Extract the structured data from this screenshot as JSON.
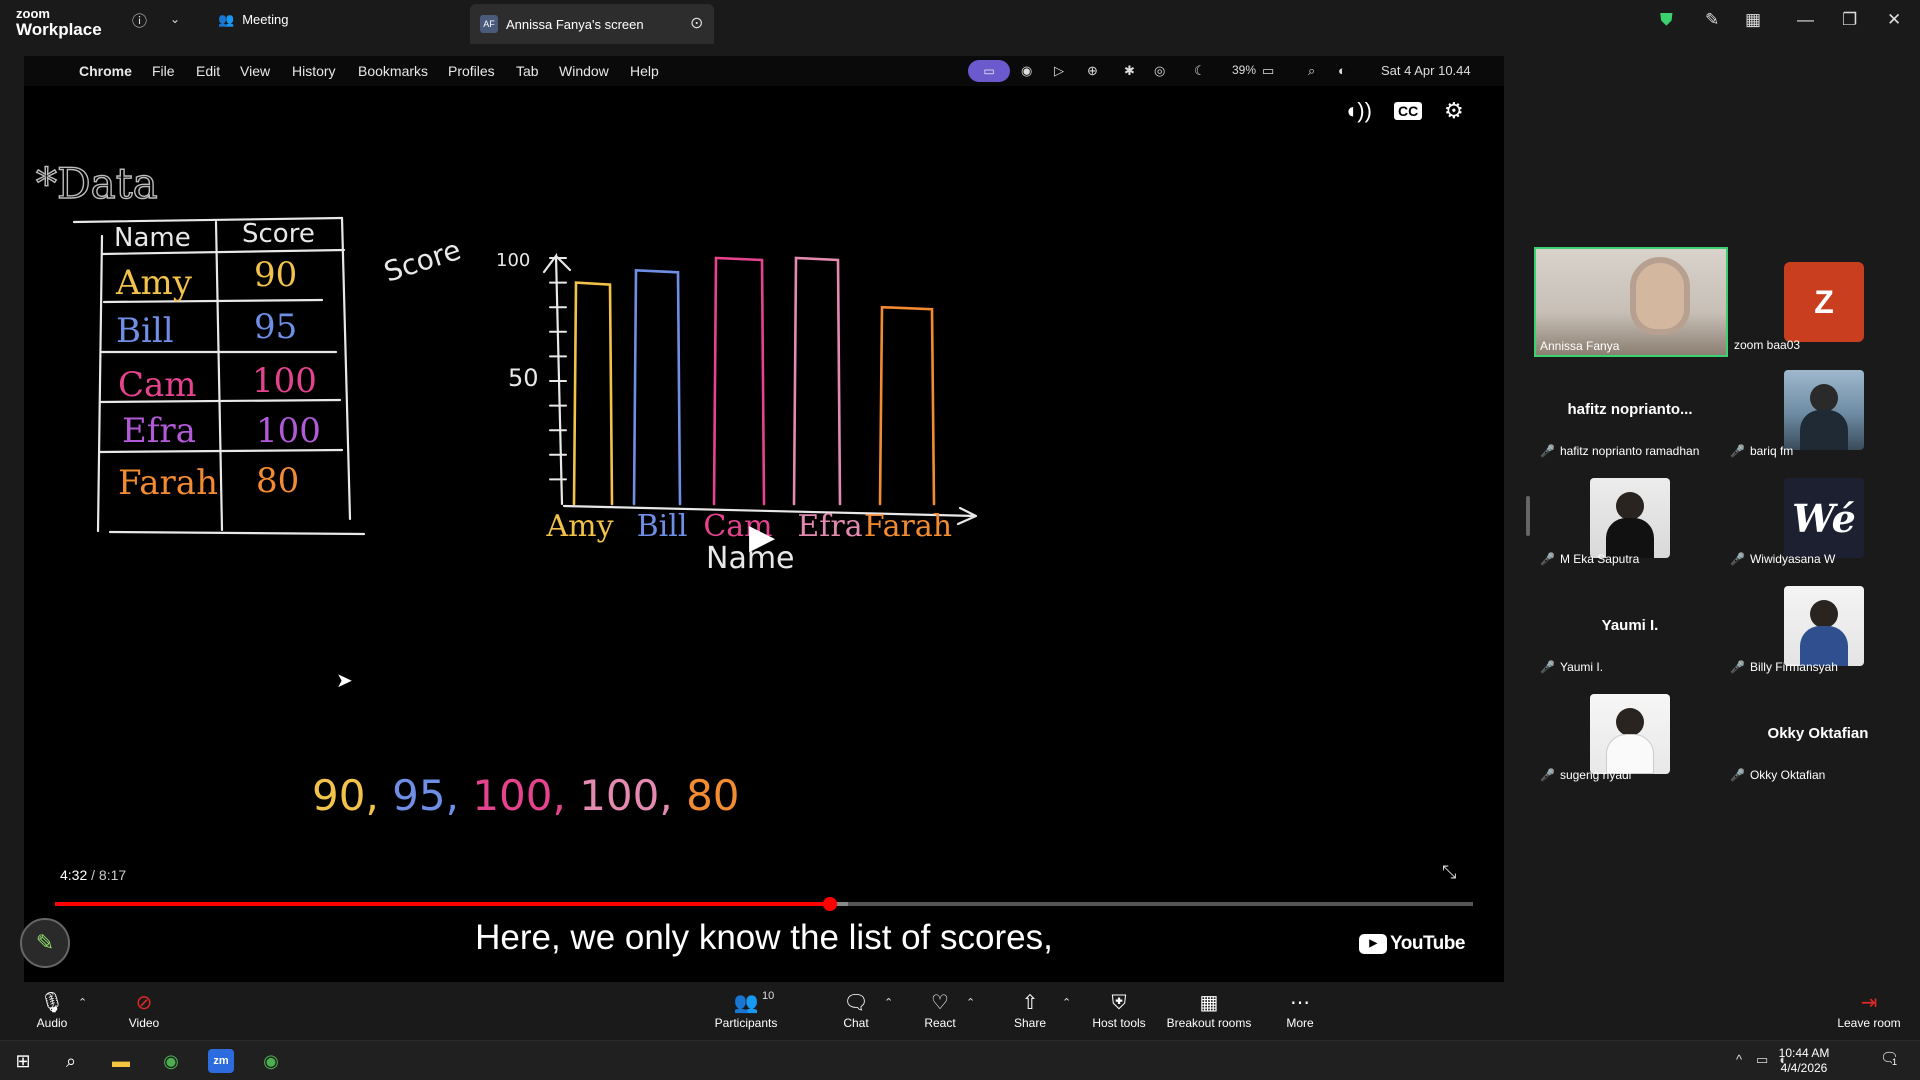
{
  "zoom": {
    "logo_top": "zoom",
    "logo_bottom": "Workplace",
    "meeting_label": "Meeting",
    "shared_tab_avatar": "AF",
    "shared_tab_title": "Annissa Fanya's screen"
  },
  "mac_menubar": {
    "app": "Chrome",
    "menus": [
      "File",
      "Edit",
      "View",
      "History",
      "Bookmarks",
      "Profiles",
      "Tab",
      "Window",
      "Help"
    ],
    "battery": "39%",
    "datetime": "Sat 4 Apr 10.44"
  },
  "video": {
    "current_time": "4:32",
    "separator": " / ",
    "duration": "8:17",
    "progress_fraction": 0.5466,
    "buffered_fraction": 0.559,
    "caption": "Here, we only know the list of scores,",
    "youtube_label": "YouTube",
    "cc_label": "CC"
  },
  "whiteboard": {
    "heading": "*Data",
    "table_headers": [
      "Name",
      "Score"
    ],
    "table_rows": [
      [
        "Amy",
        "90"
      ],
      [
        "Bill",
        "95"
      ],
      [
        "Cam",
        "100"
      ],
      [
        "Efra",
        "100"
      ],
      [
        "Farah",
        "80"
      ]
    ],
    "ylabel": "Score",
    "xlabel": "Name",
    "ytick_labels": [
      "100",
      "50"
    ],
    "bar_names": [
      "Amy",
      "Bill",
      "Cam",
      "Efra",
      "Farah"
    ],
    "score_list": "90, 95, 100, 100, 80"
  },
  "chart_data": {
    "type": "bar",
    "categories": [
      "Amy",
      "Bill",
      "Cam",
      "Efra",
      "Farah"
    ],
    "values": [
      90,
      95,
      100,
      100,
      80
    ],
    "xlabel": "Name",
    "ylabel": "Score",
    "ylim": [
      0,
      100
    ],
    "colors": [
      "#f2c24a",
      "#6f8fe6",
      "#e6438f",
      "#e48ab0",
      "#f28b32"
    ]
  },
  "participants": [
    {
      "name": "Annissa Fanya",
      "type": "video",
      "muted": false
    },
    {
      "name": "zoom baa03",
      "type": "letter",
      "letter": "Z"
    },
    {
      "name": "hafitz noprianto ramadhan",
      "display": "hafitz  noprianto...",
      "type": "name",
      "muted": true
    },
    {
      "name": "bariq fm",
      "type": "photo",
      "muted": true
    },
    {
      "name": "M Eka Saputra",
      "type": "photo",
      "muted": true
    },
    {
      "name": "Wiwidyasana W",
      "type": "logo",
      "logo_text": "Wé",
      "muted": true
    },
    {
      "name": "Yaumi I.",
      "display": "Yaumi I.",
      "type": "name",
      "muted": true
    },
    {
      "name": "Billy Firmansyah",
      "type": "photo",
      "muted": true
    },
    {
      "name": "sugeng riyadi",
      "type": "photo",
      "muted": true
    },
    {
      "name": "Okky Oktafian",
      "display": "Okky Oktafian",
      "type": "name",
      "muted": true
    }
  ],
  "toolbar": {
    "audio": "Audio",
    "video": "Video",
    "participants": "Participants",
    "participants_count": "10",
    "chat": "Chat",
    "react": "React",
    "share": "Share",
    "host_tools": "Host tools",
    "breakout_rooms": "Breakout rooms",
    "more": "More",
    "leave": "Leave room"
  },
  "taskbar": {
    "time": "10:44 AM",
    "date": "4/4/2026",
    "notifications": "1"
  }
}
